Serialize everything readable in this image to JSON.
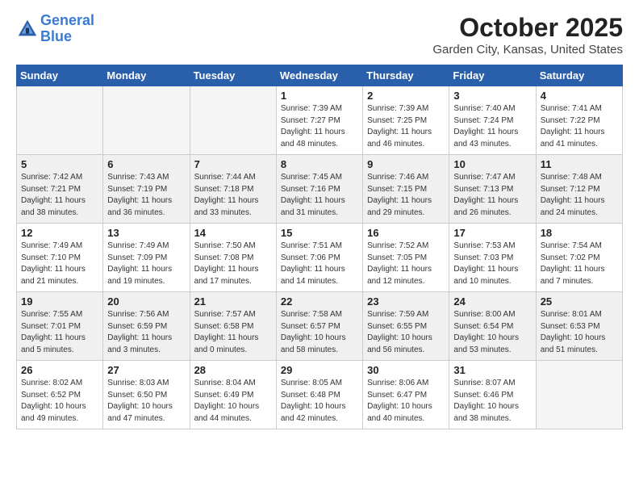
{
  "header": {
    "logo_line1": "General",
    "logo_line2": "Blue",
    "month": "October 2025",
    "location": "Garden City, Kansas, United States"
  },
  "weekdays": [
    "Sunday",
    "Monday",
    "Tuesday",
    "Wednesday",
    "Thursday",
    "Friday",
    "Saturday"
  ],
  "weeks": [
    [
      {
        "day": "",
        "sunrise": "",
        "sunset": "",
        "daylight": ""
      },
      {
        "day": "",
        "sunrise": "",
        "sunset": "",
        "daylight": ""
      },
      {
        "day": "",
        "sunrise": "",
        "sunset": "",
        "daylight": ""
      },
      {
        "day": "1",
        "sunrise": "Sunrise: 7:39 AM",
        "sunset": "Sunset: 7:27 PM",
        "daylight": "Daylight: 11 hours and 48 minutes."
      },
      {
        "day": "2",
        "sunrise": "Sunrise: 7:39 AM",
        "sunset": "Sunset: 7:25 PM",
        "daylight": "Daylight: 11 hours and 46 minutes."
      },
      {
        "day": "3",
        "sunrise": "Sunrise: 7:40 AM",
        "sunset": "Sunset: 7:24 PM",
        "daylight": "Daylight: 11 hours and 43 minutes."
      },
      {
        "day": "4",
        "sunrise": "Sunrise: 7:41 AM",
        "sunset": "Sunset: 7:22 PM",
        "daylight": "Daylight: 11 hours and 41 minutes."
      }
    ],
    [
      {
        "day": "5",
        "sunrise": "Sunrise: 7:42 AM",
        "sunset": "Sunset: 7:21 PM",
        "daylight": "Daylight: 11 hours and 38 minutes."
      },
      {
        "day": "6",
        "sunrise": "Sunrise: 7:43 AM",
        "sunset": "Sunset: 7:19 PM",
        "daylight": "Daylight: 11 hours and 36 minutes."
      },
      {
        "day": "7",
        "sunrise": "Sunrise: 7:44 AM",
        "sunset": "Sunset: 7:18 PM",
        "daylight": "Daylight: 11 hours and 33 minutes."
      },
      {
        "day": "8",
        "sunrise": "Sunrise: 7:45 AM",
        "sunset": "Sunset: 7:16 PM",
        "daylight": "Daylight: 11 hours and 31 minutes."
      },
      {
        "day": "9",
        "sunrise": "Sunrise: 7:46 AM",
        "sunset": "Sunset: 7:15 PM",
        "daylight": "Daylight: 11 hours and 29 minutes."
      },
      {
        "day": "10",
        "sunrise": "Sunrise: 7:47 AM",
        "sunset": "Sunset: 7:13 PM",
        "daylight": "Daylight: 11 hours and 26 minutes."
      },
      {
        "day": "11",
        "sunrise": "Sunrise: 7:48 AM",
        "sunset": "Sunset: 7:12 PM",
        "daylight": "Daylight: 11 hours and 24 minutes."
      }
    ],
    [
      {
        "day": "12",
        "sunrise": "Sunrise: 7:49 AM",
        "sunset": "Sunset: 7:10 PM",
        "daylight": "Daylight: 11 hours and 21 minutes."
      },
      {
        "day": "13",
        "sunrise": "Sunrise: 7:49 AM",
        "sunset": "Sunset: 7:09 PM",
        "daylight": "Daylight: 11 hours and 19 minutes."
      },
      {
        "day": "14",
        "sunrise": "Sunrise: 7:50 AM",
        "sunset": "Sunset: 7:08 PM",
        "daylight": "Daylight: 11 hours and 17 minutes."
      },
      {
        "day": "15",
        "sunrise": "Sunrise: 7:51 AM",
        "sunset": "Sunset: 7:06 PM",
        "daylight": "Daylight: 11 hours and 14 minutes."
      },
      {
        "day": "16",
        "sunrise": "Sunrise: 7:52 AM",
        "sunset": "Sunset: 7:05 PM",
        "daylight": "Daylight: 11 hours and 12 minutes."
      },
      {
        "day": "17",
        "sunrise": "Sunrise: 7:53 AM",
        "sunset": "Sunset: 7:03 PM",
        "daylight": "Daylight: 11 hours and 10 minutes."
      },
      {
        "day": "18",
        "sunrise": "Sunrise: 7:54 AM",
        "sunset": "Sunset: 7:02 PM",
        "daylight": "Daylight: 11 hours and 7 minutes."
      }
    ],
    [
      {
        "day": "19",
        "sunrise": "Sunrise: 7:55 AM",
        "sunset": "Sunset: 7:01 PM",
        "daylight": "Daylight: 11 hours and 5 minutes."
      },
      {
        "day": "20",
        "sunrise": "Sunrise: 7:56 AM",
        "sunset": "Sunset: 6:59 PM",
        "daylight": "Daylight: 11 hours and 3 minutes."
      },
      {
        "day": "21",
        "sunrise": "Sunrise: 7:57 AM",
        "sunset": "Sunset: 6:58 PM",
        "daylight": "Daylight: 11 hours and 0 minutes."
      },
      {
        "day": "22",
        "sunrise": "Sunrise: 7:58 AM",
        "sunset": "Sunset: 6:57 PM",
        "daylight": "Daylight: 10 hours and 58 minutes."
      },
      {
        "day": "23",
        "sunrise": "Sunrise: 7:59 AM",
        "sunset": "Sunset: 6:55 PM",
        "daylight": "Daylight: 10 hours and 56 minutes."
      },
      {
        "day": "24",
        "sunrise": "Sunrise: 8:00 AM",
        "sunset": "Sunset: 6:54 PM",
        "daylight": "Daylight: 10 hours and 53 minutes."
      },
      {
        "day": "25",
        "sunrise": "Sunrise: 8:01 AM",
        "sunset": "Sunset: 6:53 PM",
        "daylight": "Daylight: 10 hours and 51 minutes."
      }
    ],
    [
      {
        "day": "26",
        "sunrise": "Sunrise: 8:02 AM",
        "sunset": "Sunset: 6:52 PM",
        "daylight": "Daylight: 10 hours and 49 minutes."
      },
      {
        "day": "27",
        "sunrise": "Sunrise: 8:03 AM",
        "sunset": "Sunset: 6:50 PM",
        "daylight": "Daylight: 10 hours and 47 minutes."
      },
      {
        "day": "28",
        "sunrise": "Sunrise: 8:04 AM",
        "sunset": "Sunset: 6:49 PM",
        "daylight": "Daylight: 10 hours and 44 minutes."
      },
      {
        "day": "29",
        "sunrise": "Sunrise: 8:05 AM",
        "sunset": "Sunset: 6:48 PM",
        "daylight": "Daylight: 10 hours and 42 minutes."
      },
      {
        "day": "30",
        "sunrise": "Sunrise: 8:06 AM",
        "sunset": "Sunset: 6:47 PM",
        "daylight": "Daylight: 10 hours and 40 minutes."
      },
      {
        "day": "31",
        "sunrise": "Sunrise: 8:07 AM",
        "sunset": "Sunset: 6:46 PM",
        "daylight": "Daylight: 10 hours and 38 minutes."
      },
      {
        "day": "",
        "sunrise": "",
        "sunset": "",
        "daylight": ""
      }
    ]
  ]
}
